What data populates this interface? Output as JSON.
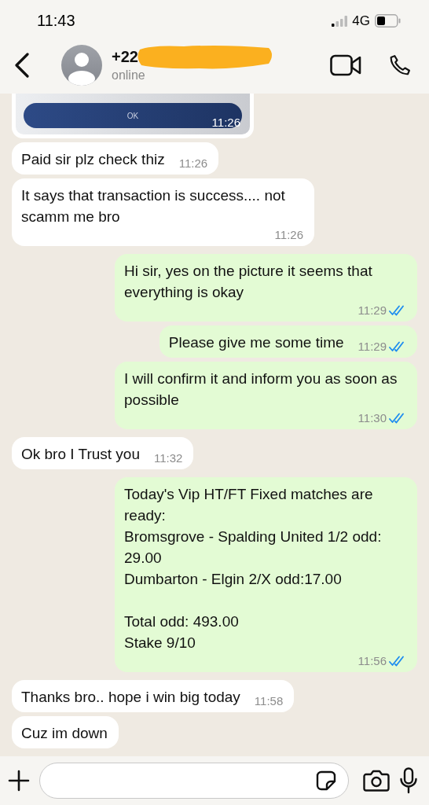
{
  "status_bar": {
    "time": "11:43",
    "network": "4G"
  },
  "header": {
    "contact_name": "+22",
    "redacted": true,
    "presence": "online"
  },
  "messages": [
    {
      "kind": "image",
      "outgoing": false,
      "button_label": "OK",
      "time": "11:26"
    },
    {
      "kind": "text",
      "outgoing": false,
      "text": "Paid sir plz check thiz",
      "time": "11:26"
    },
    {
      "kind": "text",
      "outgoing": false,
      "text": "It says that transaction is success.... not scamm me bro",
      "time": "11:26"
    },
    {
      "kind": "text",
      "outgoing": true,
      "text": "Hi sir, yes on the picture it seems that everything is okay",
      "time": "11:29",
      "read": true
    },
    {
      "kind": "text",
      "outgoing": true,
      "text": "Please give me some time",
      "time": "11:29",
      "read": true
    },
    {
      "kind": "text",
      "outgoing": true,
      "text": "I will confirm it and inform you as soon as possible",
      "time": "11:30",
      "read": true
    },
    {
      "kind": "text",
      "outgoing": false,
      "text": "Ok bro I Trust you",
      "time": "11:32"
    },
    {
      "kind": "text",
      "outgoing": true,
      "text": "Today's Vip HT/FT Fixed matches are ready:\nBromsgrove - Spalding United 1/2 odd: 29.00\nDumbarton - Elgin 2/X odd:17.00\n\nTotal odd: 493.00\nStake 9/10",
      "time": "11:56",
      "read": true
    },
    {
      "kind": "text",
      "outgoing": false,
      "text": "Thanks bro.. hope i win big today",
      "time": "11:58"
    },
    {
      "kind": "text",
      "outgoing": false,
      "text": "Cuz im down"
    }
  ]
}
